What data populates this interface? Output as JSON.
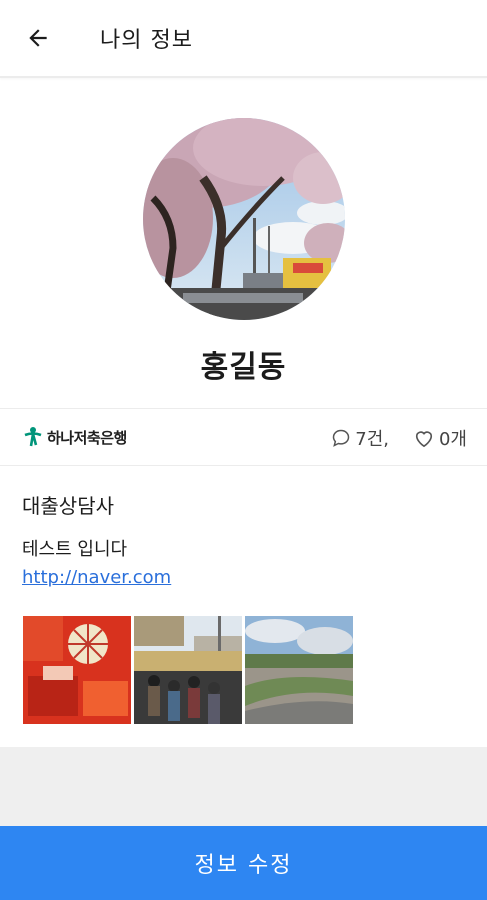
{
  "header": {
    "title": "나의 정보",
    "back_icon": "arrow-left-icon"
  },
  "profile": {
    "name": "홍길동",
    "avatar_alt": "cherry blossom street photo"
  },
  "info": {
    "bank_name": "하나저축은행",
    "comment_count": "7건,",
    "like_count": "0개",
    "accent_color": "#00957a"
  },
  "content": {
    "job_title": "대출상담사",
    "description": "테스트 입니다",
    "link": "http://naver.com"
  },
  "photos": [
    {
      "name": "photo-market-red"
    },
    {
      "name": "photo-street-crowd"
    },
    {
      "name": "photo-park-sky"
    }
  ],
  "actions": {
    "edit_label": "정보 수정",
    "button_color": "#2e86f2"
  }
}
